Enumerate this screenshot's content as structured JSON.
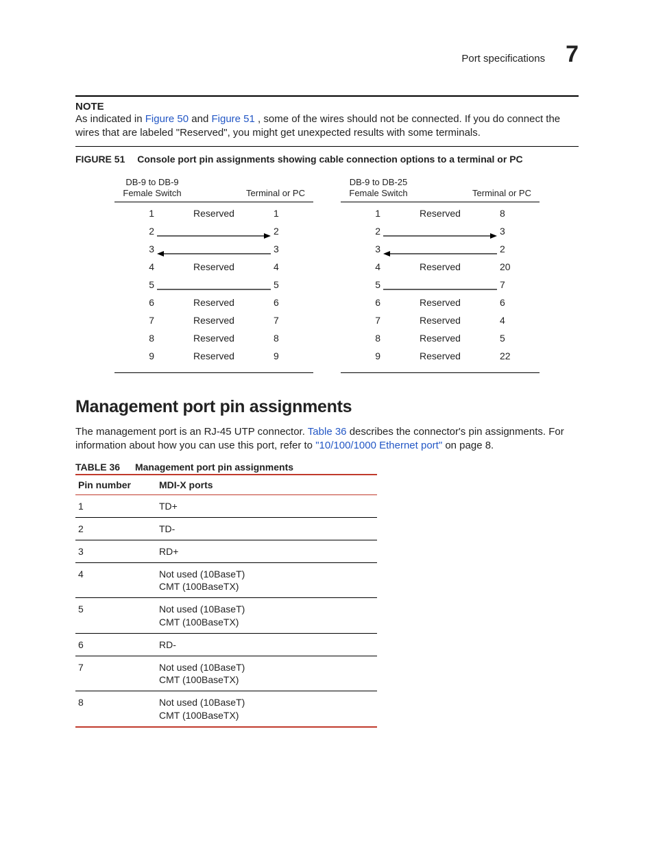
{
  "running": {
    "title": "Port specifications",
    "chapter": "7"
  },
  "note": {
    "label": "NOTE",
    "pre": "As indicated in ",
    "fig50": "Figure 50",
    "mid": " and ",
    "fig51": "Figure 51",
    "post": ", some of the wires should not be connected. If you do connect the wires that are labeled \"Reserved\", you might get unexpected results with some terminals."
  },
  "figure51": {
    "label": "FIGURE 51",
    "caption": "Console port pin assignments showing cable connection options to a terminal or PC",
    "blocks": [
      {
        "left_header1": "DB-9 to DB-9",
        "left_header2": "Female Switch",
        "right_header": "Terminal or PC",
        "rows": [
          {
            "l": "1",
            "r": "1",
            "kind": "reserved",
            "label": "Reserved"
          },
          {
            "l": "2",
            "r": "2",
            "kind": "arrowR"
          },
          {
            "l": "3",
            "r": "3",
            "kind": "arrowL"
          },
          {
            "l": "4",
            "r": "4",
            "kind": "reserved",
            "label": "Reserved"
          },
          {
            "l": "5",
            "r": "5",
            "kind": "line"
          },
          {
            "l": "6",
            "r": "6",
            "kind": "reserved",
            "label": "Reserved"
          },
          {
            "l": "7",
            "r": "7",
            "kind": "reserved",
            "label": "Reserved"
          },
          {
            "l": "8",
            "r": "8",
            "kind": "reserved",
            "label": "Reserved"
          },
          {
            "l": "9",
            "r": "9",
            "kind": "reserved",
            "label": "Reserved"
          }
        ]
      },
      {
        "left_header1": "DB-9 to DB-25",
        "left_header2": "Female Switch",
        "right_header": "Terminal or PC",
        "rows": [
          {
            "l": "1",
            "r": "8",
            "kind": "reserved",
            "label": "Reserved"
          },
          {
            "l": "2",
            "r": "3",
            "kind": "arrowR"
          },
          {
            "l": "3",
            "r": "2",
            "kind": "arrowL"
          },
          {
            "l": "4",
            "r": "20",
            "kind": "reserved",
            "label": "Reserved"
          },
          {
            "l": "5",
            "r": "7",
            "kind": "line"
          },
          {
            "l": "6",
            "r": "6",
            "kind": "reserved",
            "label": "Reserved"
          },
          {
            "l": "7",
            "r": "4",
            "kind": "reserved",
            "label": "Reserved"
          },
          {
            "l": "8",
            "r": "5",
            "kind": "reserved",
            "label": "Reserved"
          },
          {
            "l": "9",
            "r": "22",
            "kind": "reserved",
            "label": "Reserved"
          }
        ]
      }
    ]
  },
  "section": {
    "title": "Management port pin assignments",
    "para_pre": "The management port is an RJ-45 UTP connector. ",
    "table_ref": "Table 36",
    "para_mid": " describes the connector's pin assignments. For information about how you can use this port, refer to ",
    "eth_ref": "\"10/100/1000 Ethernet port\"",
    "para_post": " on page 8."
  },
  "table36": {
    "label": "TABLE 36",
    "caption": "Management port pin assignments",
    "headers": [
      "Pin number",
      "MDI-X ports"
    ],
    "rows": [
      [
        "1",
        "TD+"
      ],
      [
        "2",
        "TD-"
      ],
      [
        "3",
        "RD+"
      ],
      [
        "4",
        "Not used (10BaseT)\nCMT (100BaseTX)"
      ],
      [
        "5",
        "Not used (10BaseT)\nCMT (100BaseTX)"
      ],
      [
        "6",
        "RD-"
      ],
      [
        "7",
        "Not used (10BaseT)\nCMT (100BaseTX)"
      ],
      [
        "8",
        "Not used (10BaseT)\nCMT (100BaseTX)"
      ]
    ]
  }
}
